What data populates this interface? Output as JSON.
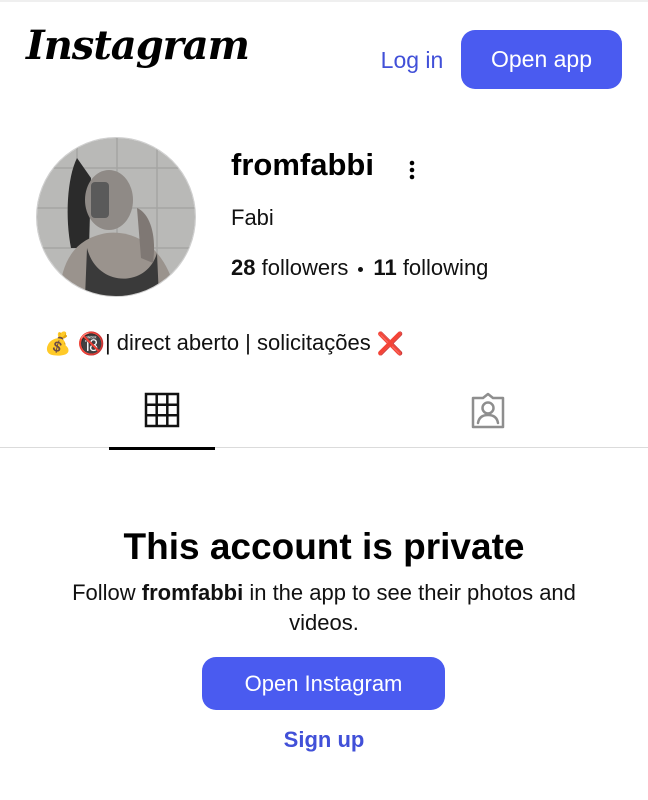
{
  "header": {
    "logo_text": "Instagram",
    "login_label": "Log in",
    "open_app_label": "Open app"
  },
  "profile": {
    "username": "fromfabbi",
    "full_name": "Fabi",
    "followers_count": "28",
    "followers_label": "followers",
    "following_count": "11",
    "following_label": "following",
    "bio_emoji_1": "💰",
    "bio_emoji_2": "🔞",
    "bio_text": "| direct aberto | solicitações",
    "bio_emoji_3": "❌"
  },
  "tabs": [
    {
      "name": "posts",
      "icon": "grid-icon",
      "active": true
    },
    {
      "name": "tagged",
      "icon": "tagged-person-icon",
      "active": false
    }
  ],
  "private": {
    "title": "This account is private",
    "desc_prefix": "Follow ",
    "desc_username": "fromfabbi",
    "desc_suffix": " in the app to see their photos and videos.",
    "open_instagram_label": "Open Instagram",
    "signup_label": "Sign up"
  },
  "colors": {
    "accent": "#4a5bf0",
    "link": "#4150d8"
  }
}
